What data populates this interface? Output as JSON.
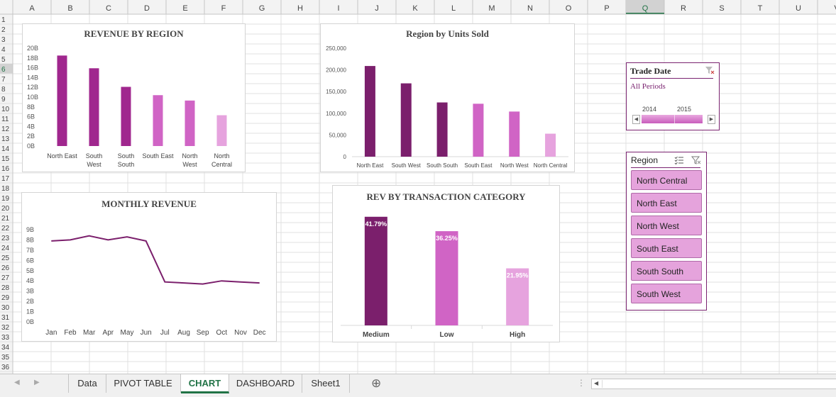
{
  "sheet": {
    "columns": [
      "A",
      "B",
      "C",
      "D",
      "E",
      "F",
      "G",
      "H",
      "I",
      "J",
      "K",
      "L",
      "M",
      "N",
      "O",
      "P",
      "Q",
      "R",
      "S",
      "T",
      "U",
      "V"
    ],
    "selected_column": "Q",
    "selected_row": "6",
    "rows": [
      "1",
      "2",
      "3",
      "4",
      "5",
      "6",
      "7",
      "8",
      "9",
      "10",
      "11",
      "12",
      "13",
      "14",
      "15",
      "16",
      "17",
      "18",
      "19",
      "20",
      "21",
      "22",
      "23",
      "24",
      "25",
      "26",
      "27",
      "28",
      "29",
      "30",
      "31",
      "32",
      "33",
      "34",
      "35",
      "36"
    ]
  },
  "chart_data": [
    {
      "type": "bar",
      "title": "REVENUE BY REGION",
      "categories": [
        "North East",
        "South West",
        "South South",
        "South East",
        "North West",
        "North Central"
      ],
      "values": [
        18.5,
        15.9,
        12.1,
        10.4,
        9.3,
        6.3
      ],
      "unit": "B",
      "yticks": [
        "20B",
        "18B",
        "16B",
        "14B",
        "12B",
        "10B",
        "8B",
        "6B",
        "4B",
        "2B",
        "0B"
      ],
      "ylim": [
        0,
        20
      ],
      "colors": [
        "#a0278e",
        "#a0278e",
        "#a0278e",
        "#d064c5",
        "#d064c5",
        "#e6a3de"
      ]
    },
    {
      "type": "bar",
      "title": "Region by Units Sold",
      "categories": [
        "North East",
        "South West",
        "South South",
        "South East",
        "North West",
        "North Central"
      ],
      "values": [
        209000,
        169000,
        125000,
        122000,
        104000,
        53000
      ],
      "yticks": [
        "250,000",
        "200,000",
        "150,000",
        "100,000",
        "50,000",
        "0"
      ],
      "ylim": [
        0,
        250000
      ],
      "colors": [
        "#7b1f6c",
        "#7b1f6c",
        "#7b1f6c",
        "#d064c5",
        "#d064c5",
        "#e6a3de"
      ]
    },
    {
      "type": "line",
      "title": "MONTHLY REVENUE",
      "x": [
        "Jan",
        "Feb",
        "Mar",
        "Apr",
        "May",
        "Jun",
        "Jul",
        "Aug",
        "Sep",
        "Oct",
        "Nov",
        "Dec"
      ],
      "values": [
        7.9,
        8.0,
        8.4,
        8.0,
        8.3,
        7.9,
        3.9,
        3.8,
        3.7,
        4.0,
        3.9,
        3.8
      ],
      "unit": "B",
      "yticks": [
        "9B",
        "8B",
        "7B",
        "6B",
        "5B",
        "4B",
        "3B",
        "2B",
        "1B",
        "0B"
      ],
      "ylim": [
        0,
        9
      ],
      "color": "#7b1f6c"
    },
    {
      "type": "bar",
      "title": "REV BY TRANSACTION CATEGORY",
      "categories": [
        "Medium",
        "Low",
        "High"
      ],
      "values": [
        41.79,
        36.25,
        21.95
      ],
      "labels": [
        "41.79%",
        "36.25%",
        "21.95%"
      ],
      "ylim": [
        0,
        45
      ],
      "colors": [
        "#7b1f6c",
        "#d064c5",
        "#e6a3de"
      ]
    }
  ],
  "trade_date_slicer": {
    "title": "Trade Date",
    "periods_label": "All Periods",
    "years": [
      "2014",
      "2015"
    ]
  },
  "region_slicer": {
    "title": "Region",
    "items": [
      "North Central",
      "North East",
      "North West",
      "South East",
      "South South",
      "South West"
    ]
  },
  "tabs": [
    {
      "label": "Data",
      "active": false
    },
    {
      "label": "PIVOT TABLE",
      "active": false
    },
    {
      "label": "CHART",
      "active": true
    },
    {
      "label": "DASHBOARD",
      "active": false
    },
    {
      "label": "Sheet1",
      "active": false
    }
  ],
  "add_sheet_symbol": "⊕"
}
